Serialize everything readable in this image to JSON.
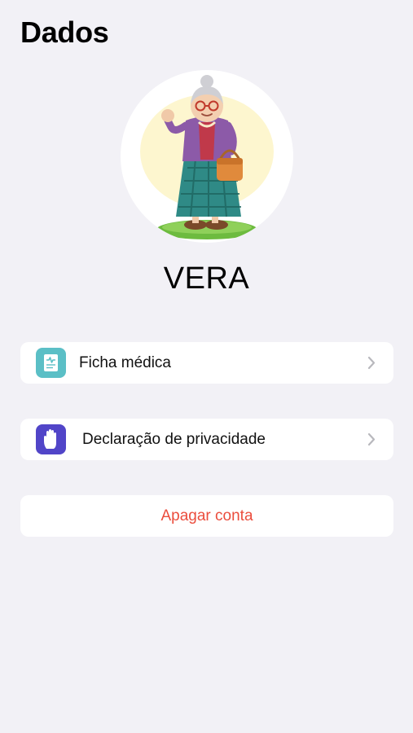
{
  "header": {
    "title": "Dados"
  },
  "profile": {
    "name": "VERA",
    "avatar_icon": "grandma-avatar-illustration"
  },
  "menu": {
    "items": [
      {
        "label": "Ficha médica",
        "icon": "medical-record-icon",
        "icon_color": "#5bbfc6"
      },
      {
        "label": "Declaração de privacidade",
        "icon": "raised-hand-icon",
        "icon_color": "#5145c8"
      }
    ],
    "delete_label": "Apagar conta"
  },
  "colors": {
    "background": "#f2f1f6",
    "card": "#ffffff",
    "destructive": "#eb4d3d",
    "chevron": "#b8b8bd"
  }
}
